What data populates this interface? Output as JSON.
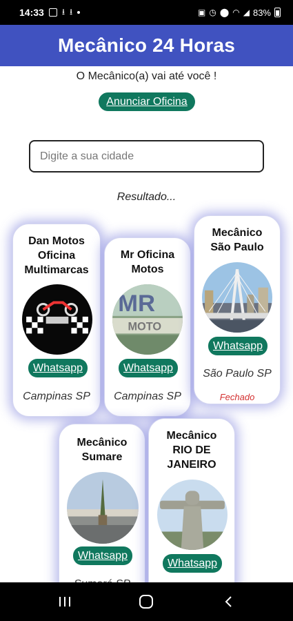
{
  "status_bar": {
    "time": "14:33",
    "battery": "83%",
    "icons": [
      "notification-icon",
      "download-icon",
      "download-icon",
      "dot-icon",
      "lock-icon",
      "alarm-icon",
      "location-icon",
      "wifi-icon",
      "signal-icon",
      "battery-icon"
    ]
  },
  "header": {
    "title": "Mecânico 24 Horas"
  },
  "intro": {
    "tagline": "O Mecânico(a) vai até você !",
    "cta_label": "Anunciar Oficina"
  },
  "search": {
    "placeholder": "Digite a sua cidade",
    "value": ""
  },
  "results": {
    "label": "Resultado...",
    "cards": [
      {
        "title_lines": [
          "Dan Motos",
          "Oficina",
          "Multimarcas"
        ],
        "photo": "motorcycle-logo",
        "whatsapp_label": "Whatsapp",
        "city": "Campinas SP",
        "status": ""
      },
      {
        "title_lines": [
          "Mr Oficina",
          "Motos"
        ],
        "photo": "storefront-sign",
        "whatsapp_label": "Whatsapp",
        "city": "Campinas SP",
        "status": ""
      },
      {
        "title_lines": [
          "Mecânico",
          "São Paulo"
        ],
        "photo": "sao-paulo-bridge",
        "whatsapp_label": "Whatsapp",
        "city": "São Paulo SP",
        "status": "Fechado"
      },
      {
        "title_lines": [
          "Mecânico",
          "Sumare"
        ],
        "photo": "sumare-monument",
        "whatsapp_label": "Whatsapp",
        "city": "Sumaré SP",
        "status": ""
      },
      {
        "title_lines": [
          "Mecânico",
          "RIO DE",
          "JANEIRO"
        ],
        "photo": "christ-redeemer",
        "whatsapp_label": "Whatsapp",
        "city": "",
        "status": ""
      }
    ]
  },
  "colors": {
    "header_bg": "#4052c0",
    "button_bg": "#10785e",
    "closed_text": "#d32f2f",
    "card_glow": "#5a5fd2"
  },
  "nav_bar": {
    "icons": [
      "recent-apps-icon",
      "home-icon",
      "back-icon"
    ]
  }
}
